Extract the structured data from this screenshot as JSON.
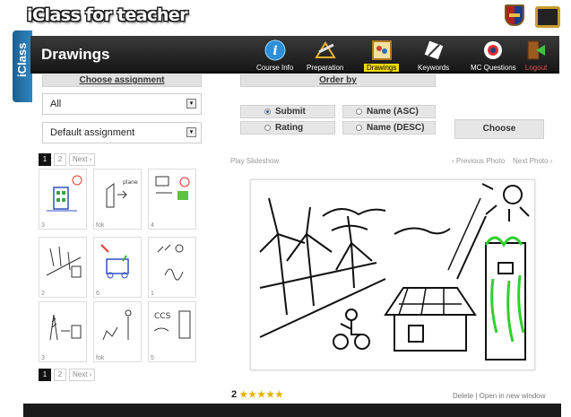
{
  "brand": {
    "title": "iClass for teacher"
  },
  "header": {
    "title": "Drawings",
    "side_tab": "iClass",
    "nav": [
      {
        "label": "Course Info",
        "icon": "info-icon",
        "active": false
      },
      {
        "label": "Preparation",
        "icon": "preparation-icon",
        "active": false
      },
      {
        "label": "Drawings",
        "icon": "drawings-icon",
        "active": true
      },
      {
        "label": "Keywords",
        "icon": "keywords-icon",
        "active": false
      },
      {
        "label": "MC Questions",
        "icon": "mc-questions-icon",
        "active": false
      },
      {
        "label": "Logout",
        "icon": "logout-icon",
        "active": false
      }
    ]
  },
  "assignment": {
    "heading": "Choose assignment",
    "filter_value": "All",
    "assignment_value": "Default assignment"
  },
  "order": {
    "heading": "Order by",
    "options": [
      "Submit",
      "Rating",
      "Name (ASC)",
      "Name (DESC)"
    ],
    "selected": "Submit",
    "choose_label": "Choose"
  },
  "pagination": {
    "pages": [
      "1",
      "2"
    ],
    "current": "1",
    "next_label": "Next ›"
  },
  "thumbnails": [
    {
      "caption": "3"
    },
    {
      "caption": "fok"
    },
    {
      "caption": "4"
    },
    {
      "caption": "2"
    },
    {
      "caption": "6"
    },
    {
      "caption": "1"
    },
    {
      "caption": "3"
    },
    {
      "caption": "fok"
    },
    {
      "caption": "5"
    }
  ],
  "viewer": {
    "play_slideshow": "Play Slideshow",
    "previous_photo": "‹ Previous Photo",
    "next_photo": "Next Photo ›",
    "rating_value": "2",
    "rating_stars": 5,
    "delete_label": "Delete",
    "separator": "|",
    "open_label": "Open in new window"
  },
  "colors": {
    "active_nav": "#f2d900",
    "side_tab": "#2f86c0",
    "header_bg": "#1e1e1e"
  }
}
